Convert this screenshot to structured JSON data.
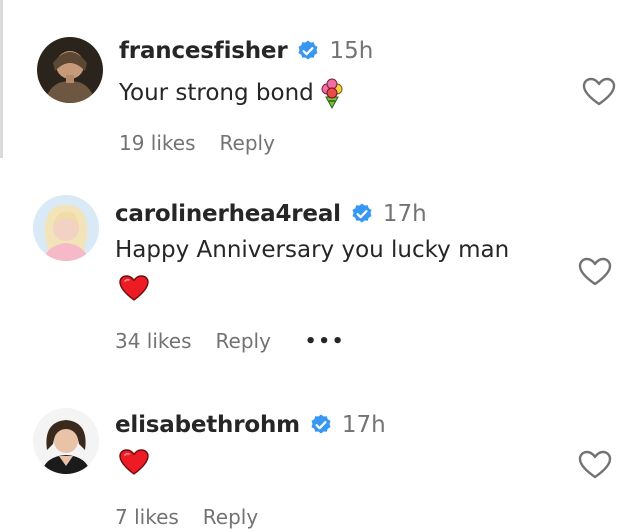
{
  "comments": [
    {
      "username": "francesfisher",
      "time": "15h",
      "text": "Your strong bond",
      "emoji_icon": "bouquet-icon",
      "likes": "19 likes",
      "reply": "Reply"
    },
    {
      "username": "carolinerhea4real",
      "time": "17h",
      "text": "Happy Anniversary you lucky man",
      "emoji_icon": "red-heart-icon",
      "likes": "34 likes",
      "reply": "Reply",
      "more": "•••"
    },
    {
      "username": "elisabethrohm",
      "time": "17h",
      "text": "",
      "emoji_icon": "red-heart-icon",
      "likes": "7 likes",
      "reply": "Reply"
    }
  ],
  "colors": {
    "verified": "#3897f0",
    "heart": "#ed1c24",
    "muted": "#737373"
  }
}
